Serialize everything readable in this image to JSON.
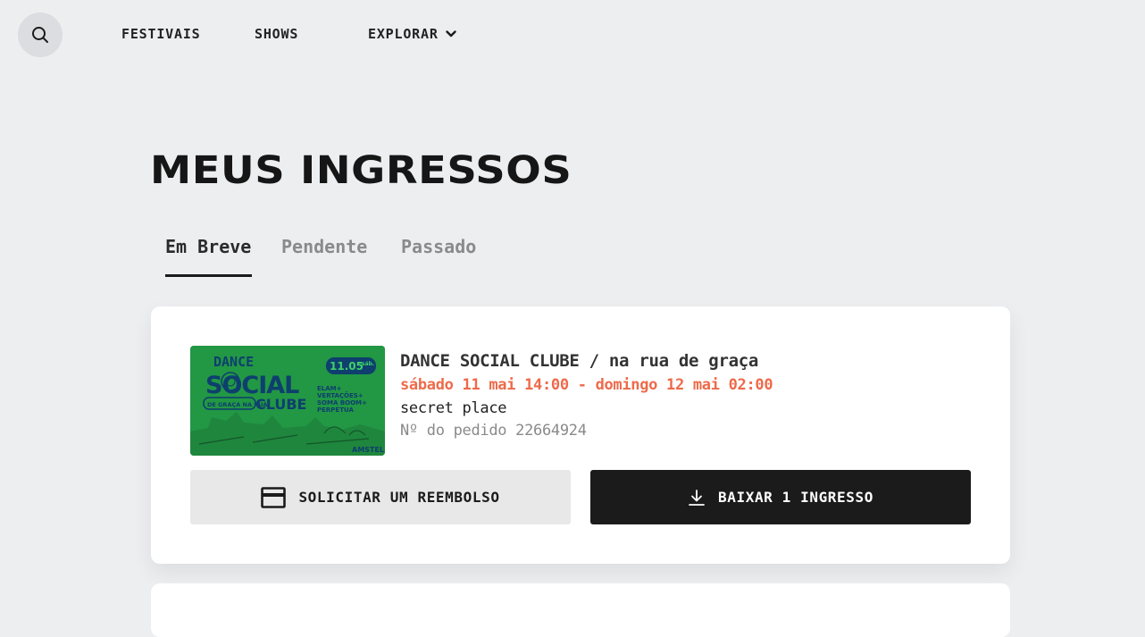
{
  "nav": {
    "search_icon": "search-icon",
    "items": [
      {
        "label": "FESTIVAIS"
      },
      {
        "label": "SHOWS"
      },
      {
        "label": "EXPLORAR"
      }
    ]
  },
  "page": {
    "title": "MEUS INGRESSOS"
  },
  "tabs": [
    {
      "label": "Em Breve",
      "active": true
    },
    {
      "label": "Pendente",
      "active": false
    },
    {
      "label": "Passado",
      "active": false
    }
  ],
  "ticket": {
    "poster": {
      "line1": "DANCE",
      "line2": "SOCIAL",
      "line3": "CLUBE",
      "subtitle": "DE GRAÇA NA RUA",
      "date_badge": "11.05",
      "day_badge": "sáb.",
      "lineup": [
        "ELAM+",
        "VERTAÇÕES+",
        "SOMA BOOM+",
        "PERPÉTUA"
      ],
      "sponsor": "AMSTEL",
      "color": "#229744"
    },
    "title": "DANCE SOCIAL CLUBE / na rua de graça",
    "dates": "sábado 11 mai 14:00 - domingo 12 mai 02:00",
    "venue": "secret place",
    "order": "Nº do pedido 22664924",
    "refund_label": "SOLICITAR UM REEMBOLSO",
    "download_label": "BAIXAR 1 INGRESSO"
  },
  "colors": {
    "accent_date": "#ee6a4a",
    "dark_button": "#1b1b1b",
    "background": "#edeef0"
  }
}
